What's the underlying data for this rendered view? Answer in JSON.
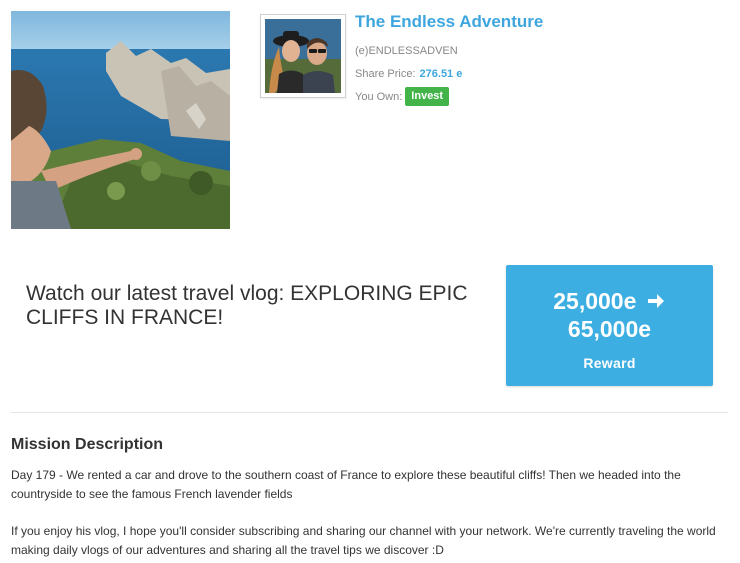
{
  "profile": {
    "name": "The Endless Adventure",
    "handle": "(e)ENDLESSADVEN",
    "share_price_label": "Share Price:",
    "share_price_value": "276.51 e",
    "you_own_label": "You Own:",
    "invest_label": "Invest"
  },
  "mission": {
    "title": "Watch our latest travel vlog: EXPLORING EPIC CLIFFS IN FRANCE!"
  },
  "reward": {
    "from_amount": "25,000e",
    "to_amount": "65,000e",
    "label": "Reward",
    "arrow_icon": "arrow-right-icon",
    "color": "#3daee2"
  },
  "description": {
    "heading": "Mission Description",
    "paragraphs": [
      "Day 179 - We rented a car and drove to the southern coast of France to explore these beautiful cliffs! Then we headed into the countryside to see the famous French lavender fields",
      "If you enjoy his vlog, I hope you'll consider subscribing and sharing our channel with your network. We're currently traveling the world making daily vlogs of our adventures and sharing all the travel tips we discover :D"
    ]
  },
  "colors": {
    "accent_blue": "#3ea6df",
    "invest_green": "#43b44a",
    "muted_text": "#888888"
  }
}
